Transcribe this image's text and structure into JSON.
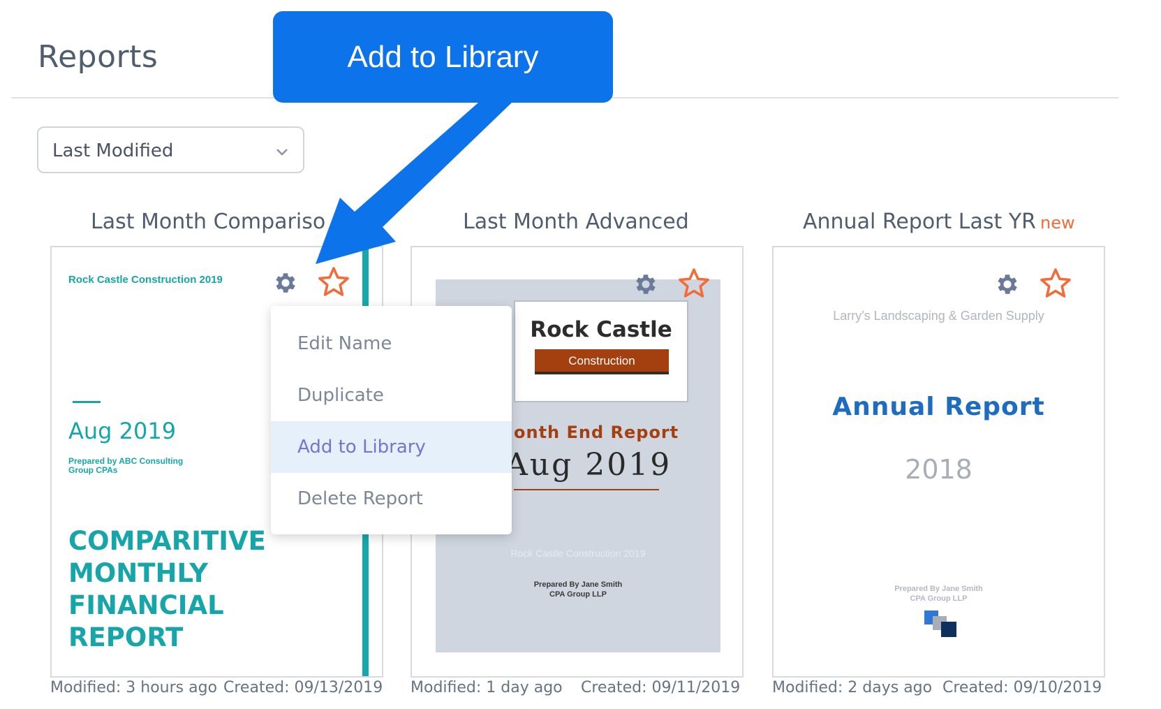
{
  "page": {
    "title": "Reports"
  },
  "sort": {
    "selected": "Last Modified"
  },
  "cards": [
    {
      "title": "Last Month Compariso",
      "cover": {
        "company": "Rock Castle Construction 2019",
        "period": "Aug 2019",
        "prepared_by": "Prepared by ABC Consulting Group CPAs",
        "heading": "COMPARITIVE MONTHLY FINANCIAL REPORT"
      },
      "modified": "Modified: 3 hours ago",
      "created": "Created: 09/13/2019"
    },
    {
      "title": "Last Month Advanced",
      "cover": {
        "logo_main": "Rock Castle",
        "logo_sub": "Construction",
        "report_type": "onth End Report",
        "period": "Aug 2019",
        "company": "Rock Castle Construction 2019",
        "prepared_by_line1": "Prepared By Jane Smith",
        "prepared_by_line2": "CPA Group LLP"
      },
      "modified": "Modified: 1 day ago",
      "created": "Created: 09/11/2019"
    },
    {
      "title": "Annual Report Last YR",
      "badge": "new",
      "cover": {
        "company": "Larry's Landscaping & Garden Supply",
        "report_type": "Annual Report",
        "year": "2018",
        "prepared_by_line1": "Prepared By Jane Smith",
        "prepared_by_line2": "CPA Group LLP"
      },
      "modified": "Modified: 2 days ago",
      "created": "Created: 09/10/2019"
    }
  ],
  "menu": {
    "items": [
      {
        "label": "Edit Name"
      },
      {
        "label": "Duplicate"
      },
      {
        "label": "Add to Library",
        "active": true
      },
      {
        "label": "Delete Report"
      }
    ]
  },
  "callout": {
    "text": "Add to Library"
  },
  "colors": {
    "accent_teal": "#16a6aa",
    "star_orange": "#f26b3a",
    "gear_blue": "#6a7a9a",
    "callout_blue": "#0c73eb",
    "menu_active": "#7574cf"
  },
  "icons": [
    "chevron-down-icon",
    "gear-icon",
    "star-icon",
    "arrow-icon"
  ]
}
